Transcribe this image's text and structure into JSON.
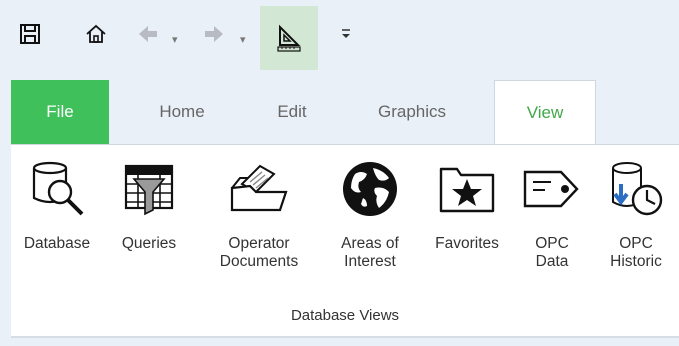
{
  "quick_access": {
    "items": [
      {
        "icon": "save-icon"
      },
      {
        "icon": "home-icon"
      },
      {
        "icon": "back-arrow-icon"
      },
      {
        "icon": "forward-arrow-icon"
      },
      {
        "icon": "ruler-triangle-icon"
      },
      {
        "icon": "customize-toolbar-icon"
      }
    ]
  },
  "tabs": [
    {
      "label": "File"
    },
    {
      "label": "Home"
    },
    {
      "label": "Edit"
    },
    {
      "label": "Graphics"
    },
    {
      "label": "View"
    }
  ],
  "ribbon": {
    "group_label": "Database Views",
    "buttons": [
      {
        "line1": "Database",
        "line2": "",
        "icon": "database-search-icon"
      },
      {
        "line1": "Queries",
        "line2": "",
        "icon": "queries-filter-icon"
      },
      {
        "line1": "Operator",
        "line2": "Documents",
        "icon": "documents-folder-icon"
      },
      {
        "line1": "Areas of",
        "line2": "Interest",
        "icon": "globe-icon"
      },
      {
        "line1": "Favorites",
        "line2": "",
        "icon": "favorites-folder-icon"
      },
      {
        "line1": "OPC",
        "line2": "Data",
        "icon": "opc-tag-icon"
      },
      {
        "line1": "OPC",
        "line2": "Historic",
        "icon": "opc-historic-icon"
      }
    ]
  },
  "colors": {
    "file_tab": "#3fc05a",
    "active_tab_text": "#40a848",
    "active_qat": "#d3e8d4"
  }
}
